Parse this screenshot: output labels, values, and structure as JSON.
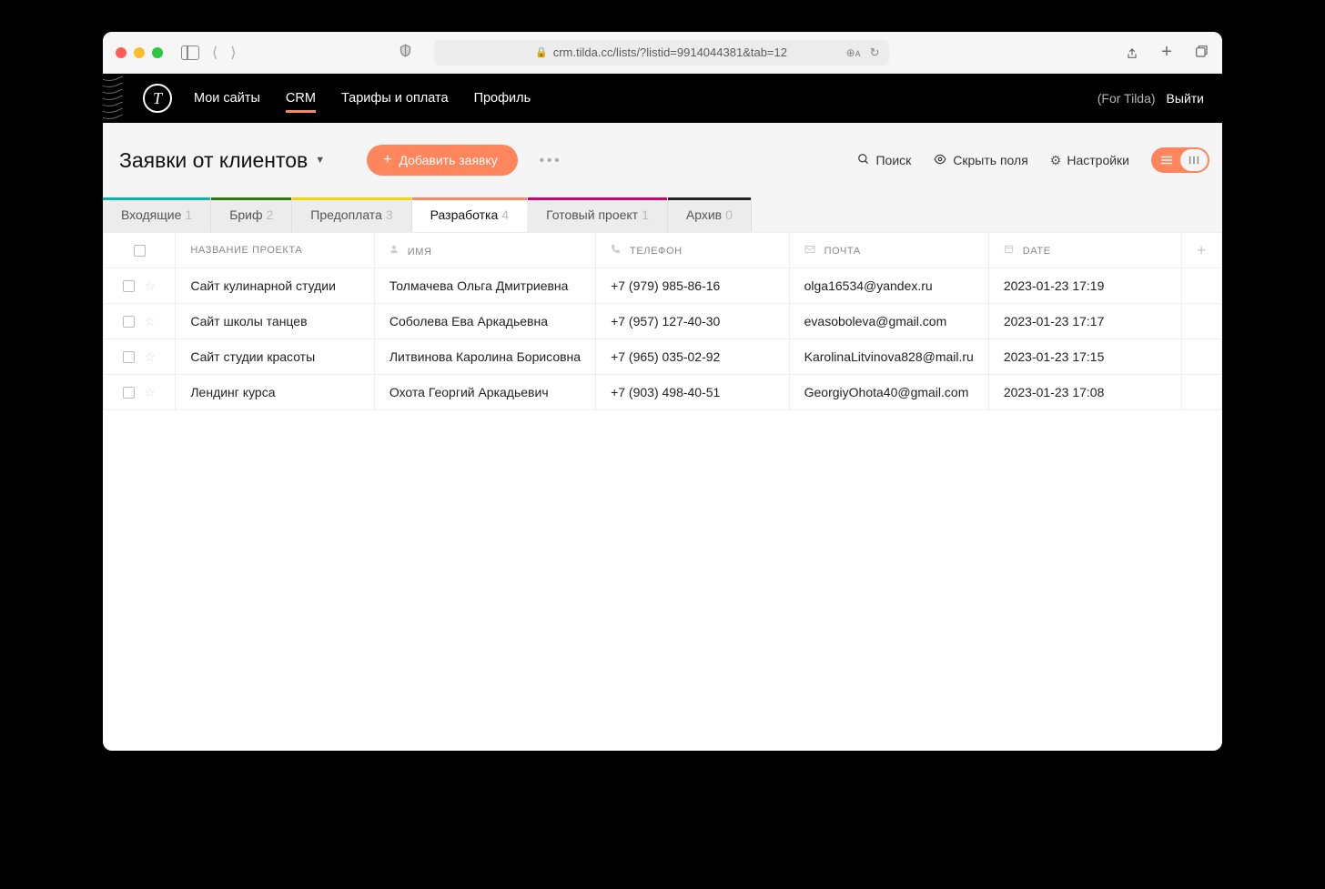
{
  "browser": {
    "url": "crm.tilda.cc/lists/?listid=9914044381&tab=12"
  },
  "header": {
    "nav": [
      "Мои сайты",
      "CRM",
      "Тарифы и оплата",
      "Профиль"
    ],
    "active_nav_index": 1,
    "account": "(For Tilda)",
    "logout": "Выйти"
  },
  "toolbar": {
    "list_title": "Заявки от клиентов",
    "add_label": "Добавить заявку",
    "search_label": "Поиск",
    "hide_fields_label": "Скрыть поля",
    "settings_label": "Настройки"
  },
  "tabs": [
    {
      "label": "Входящие",
      "count": 1,
      "color": "c1"
    },
    {
      "label": "Бриф",
      "count": 2,
      "color": "c2"
    },
    {
      "label": "Предоплата",
      "count": 3,
      "color": "c3"
    },
    {
      "label": "Разработка",
      "count": 4,
      "color": "c4"
    },
    {
      "label": "Готовый проект",
      "count": 1,
      "color": "c5"
    },
    {
      "label": "Архив",
      "count": 0,
      "color": "c6"
    }
  ],
  "active_tab_index": 3,
  "columns": {
    "name": "НАЗВАНИЕ ПРОЕКТА",
    "person": "ИМЯ",
    "phone": "ТЕЛЕФОН",
    "email": "ПОЧТА",
    "date": "DATE"
  },
  "rows": [
    {
      "project": "Сайт кулинарной студии",
      "person": "Толмачева Ольга Дмитриевна",
      "phone": "+7 (979) 985-86-16",
      "email": "olga16534@yandex.ru",
      "date": "2023-01-23 17:19"
    },
    {
      "project": "Сайт школы танцев",
      "person": "Соболева Ева Аркадьевна",
      "phone": "+7 (957) 127-40-30",
      "email": "evasoboleva@gmail.com",
      "date": "2023-01-23 17:17"
    },
    {
      "project": "Сайт студии красоты",
      "person": "Литвинова Каролина Борисовна",
      "phone": "+7 (965) 035-02-92",
      "email": "KarolinaLitvinova828@mail.ru",
      "date": "2023-01-23 17:15"
    },
    {
      "project": "Лендинг курса",
      "person": "Охота Георгий Аркадьевич",
      "phone": "+7 (903) 498-40-51",
      "email": "GeorgiyOhota40@gmail.com",
      "date": "2023-01-23 17:08"
    }
  ]
}
